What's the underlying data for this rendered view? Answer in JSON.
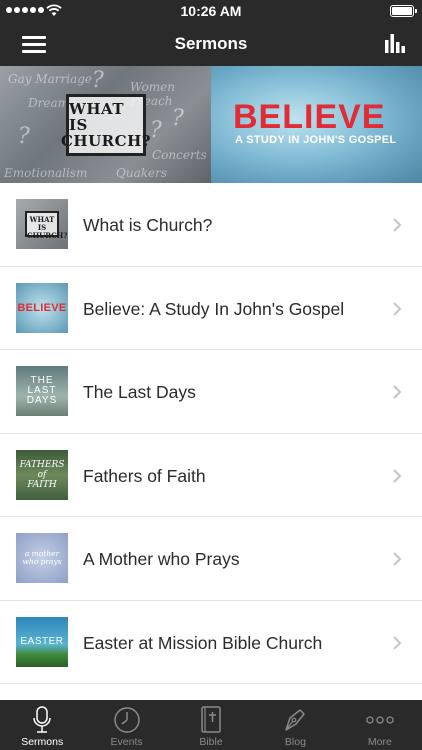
{
  "status_bar": {
    "time": "10:26 AM"
  },
  "nav": {
    "title": "Sermons"
  },
  "banner": {
    "left_title_line1": "WHAT IS",
    "left_title_line2": "CHURCH?",
    "left_scribbles": [
      "Gay Marriage",
      "Women Preach",
      "Dreams",
      "Concerts",
      "Emotionalism",
      "Quakers"
    ],
    "right_title": "BELIEVE",
    "right_subtitle": "A STUDY IN JOHN'S GOSPEL"
  },
  "sermons": [
    {
      "title": "What is Church?",
      "thumb_text": [
        "WHAT IS",
        "CHURCH?"
      ]
    },
    {
      "title": "Believe: A Study In John's Gospel",
      "thumb_text": [
        "BELIEVE"
      ]
    },
    {
      "title": "The Last Days",
      "thumb_text": [
        "THE",
        "LAST",
        "DAYS"
      ]
    },
    {
      "title": "Fathers of Faith",
      "thumb_text": [
        "FATHERS",
        "of",
        "FAITH"
      ]
    },
    {
      "title": "A Mother who Prays",
      "thumb_text": [
        "a mother",
        "who prays"
      ]
    },
    {
      "title": "Easter at Mission Bible Church",
      "thumb_text": [
        "EASTER"
      ]
    }
  ],
  "tabs": [
    {
      "label": "Sermons",
      "icon": "microphone-icon",
      "active": true
    },
    {
      "label": "Events",
      "icon": "clock-icon",
      "active": false
    },
    {
      "label": "Bible",
      "icon": "bible-icon",
      "active": false
    },
    {
      "label": "Blog",
      "icon": "pen-nib-icon",
      "active": false
    },
    {
      "label": "More",
      "icon": "more-dots-icon",
      "active": false
    }
  ],
  "colors": {
    "bar_bg": "#2a2a2a",
    "believe_red": "#e02c34",
    "tab_inactive": "#8a8a8a"
  }
}
